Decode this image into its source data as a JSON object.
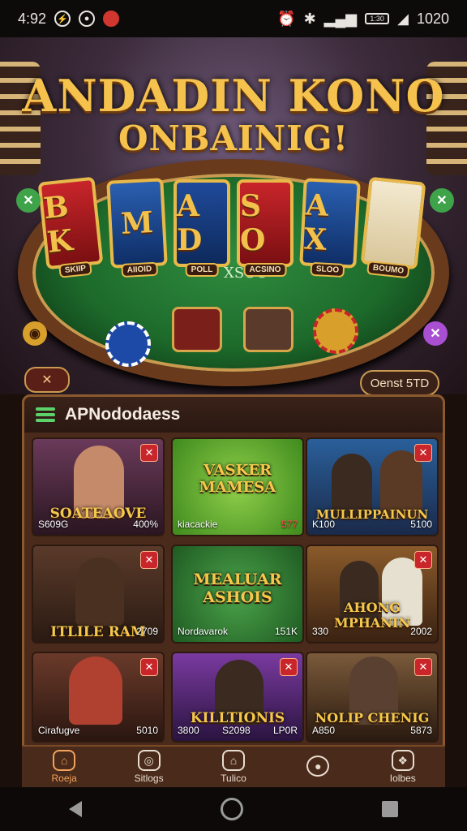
{
  "status_bar": {
    "time": "4:92",
    "battery": "1:30",
    "right_value": "1020"
  },
  "hero": {
    "title_line1": "ANDADIN KONO",
    "title_line2": "ONBAINIG!"
  },
  "cards": [
    {
      "text": "B K",
      "label": "SKIIP"
    },
    {
      "text": "M",
      "label": "AIIOID"
    },
    {
      "text": "A D",
      "label": "POLL"
    },
    {
      "text": "S O",
      "label": "ACSINO"
    },
    {
      "text": "A X",
      "label": "SLOO"
    },
    {
      "text": "",
      "label": "BOUMO"
    }
  ],
  "table_label": "XSOC",
  "top_right_badge": "Oenst 5TD",
  "panel": {
    "title": "APNododaess"
  },
  "tiles": [
    {
      "name": "SOATEAOVE",
      "foot_left": "S609G",
      "foot_right": "400%"
    },
    {
      "name": "VASKER MAMESA",
      "foot_left": "kiacackie",
      "foot_right": "577"
    },
    {
      "name": "MULLIPPAINUN",
      "foot_left": "K100",
      "foot_right": "5100"
    },
    {
      "name": "ITLILE RAM",
      "foot_left": "",
      "foot_right": "2709"
    },
    {
      "name": "MEALUAR ASHOIS",
      "foot_left": "Nordavarok",
      "foot_right": "151K"
    },
    {
      "name": "AHONG MPHANIN",
      "foot_left": "330",
      "foot_right": "2002"
    },
    {
      "name": "",
      "foot_left": "Cirafugve",
      "foot_right": "5010"
    },
    {
      "name": "KILLTIONIS",
      "foot_left": "3800",
      "foot_mid": "S2098",
      "foot_right": "LP0R"
    },
    {
      "name": "NOLIP CHENIG",
      "foot_left": "A850",
      "foot_right": "5873"
    }
  ],
  "nav": [
    {
      "label": "Roeja",
      "icon": "home-icon",
      "active": true
    },
    {
      "label": "Sitlogs",
      "icon": "users-icon"
    },
    {
      "label": "Tulico",
      "icon": "tag-icon"
    },
    {
      "label": "",
      "icon": "location-icon"
    },
    {
      "label": "Iolbes",
      "icon": "apps-icon"
    }
  ]
}
